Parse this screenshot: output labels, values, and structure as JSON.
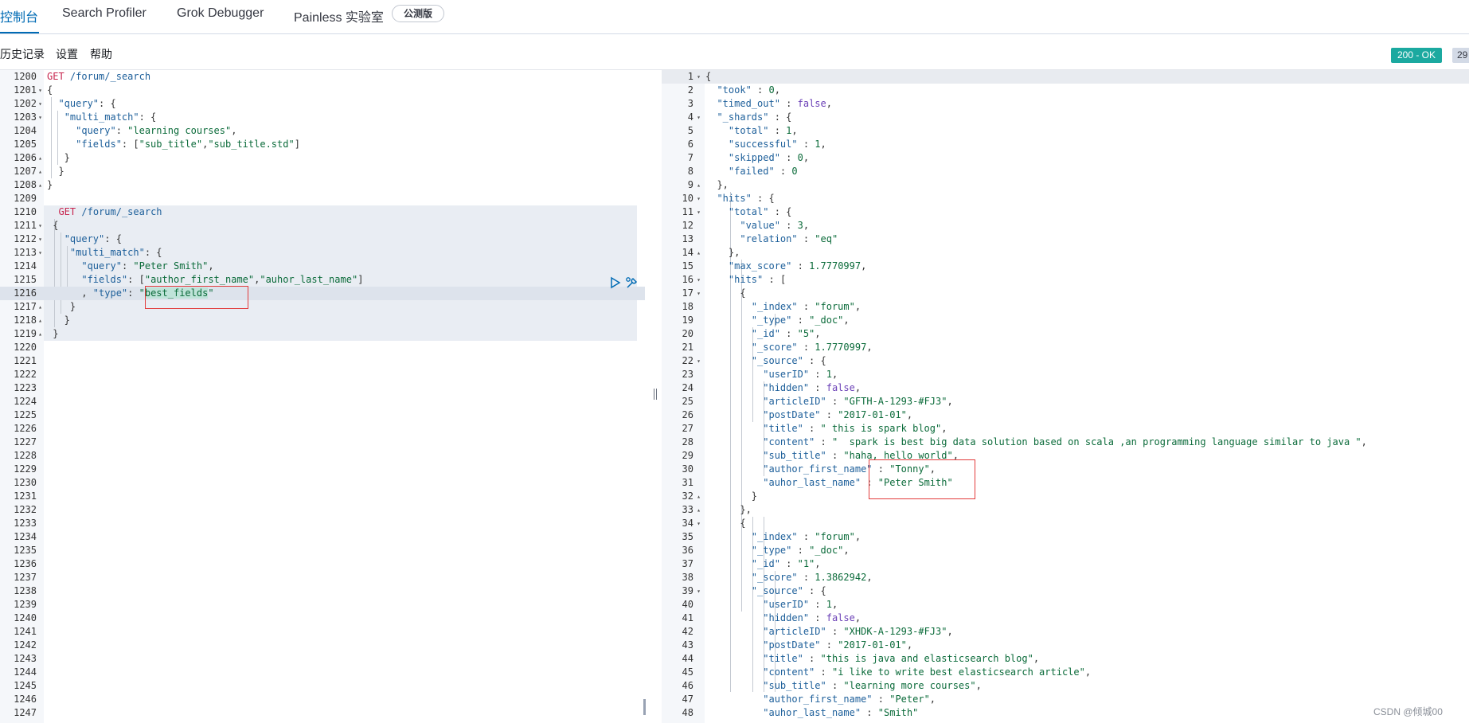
{
  "tabs": {
    "console": "控制台",
    "search_profiler": "Search Profiler",
    "grok_debugger": "Grok Debugger",
    "painless_lab": "Painless 实验室",
    "beta": "公测版"
  },
  "toolbar": {
    "history": "历史记录",
    "settings": "设置",
    "help": "帮助"
  },
  "response_status": {
    "status": "200 - OK",
    "time": "29"
  },
  "request_editor": {
    "lines": [
      {
        "n": "1200",
        "fold": "",
        "code": "GET /forum/_search"
      },
      {
        "n": "1201",
        "fold": "▾",
        "code": "{"
      },
      {
        "n": "1202",
        "fold": "▾",
        "code": "  \"query\": {"
      },
      {
        "n": "1203",
        "fold": "▾",
        "code": "   \"multi_match\": {"
      },
      {
        "n": "1204",
        "fold": "",
        "code": "     \"query\": \"learning courses\","
      },
      {
        "n": "1205",
        "fold": "",
        "code": "     \"fields\": [\"sub_title\",\"sub_title.std\"]"
      },
      {
        "n": "1206",
        "fold": "▴",
        "code": "   }"
      },
      {
        "n": "1207",
        "fold": "▴",
        "code": "  }"
      },
      {
        "n": "1208",
        "fold": "▴",
        "code": "}"
      },
      {
        "n": "1209",
        "fold": "",
        "code": ""
      },
      {
        "n": "1210",
        "fold": "",
        "code": "  GET /forum/_search"
      },
      {
        "n": "1211",
        "fold": "▾",
        "code": " {"
      },
      {
        "n": "1212",
        "fold": "▾",
        "code": "   \"query\": {"
      },
      {
        "n": "1213",
        "fold": "▾",
        "code": "    \"multi_match\": {"
      },
      {
        "n": "1214",
        "fold": "",
        "code": "      \"query\": \"Peter Smith\","
      },
      {
        "n": "1215",
        "fold": "",
        "code": "      \"fields\": [\"author_first_name\",\"auhor_last_name\"]"
      },
      {
        "n": "1216",
        "fold": "",
        "code": "      , \"type\": \"best_fields\""
      },
      {
        "n": "1217",
        "fold": "▴",
        "code": "    }"
      },
      {
        "n": "1218",
        "fold": "▴",
        "code": "   }"
      },
      {
        "n": "1219",
        "fold": "▴",
        "code": " }"
      },
      {
        "n": "1220",
        "fold": "",
        "code": ""
      },
      {
        "n": "1221",
        "fold": "",
        "code": ""
      },
      {
        "n": "1222",
        "fold": "",
        "code": ""
      },
      {
        "n": "1223",
        "fold": "",
        "code": ""
      },
      {
        "n": "1224",
        "fold": "",
        "code": ""
      },
      {
        "n": "1225",
        "fold": "",
        "code": ""
      },
      {
        "n": "1226",
        "fold": "",
        "code": ""
      },
      {
        "n": "1227",
        "fold": "",
        "code": ""
      },
      {
        "n": "1228",
        "fold": "",
        "code": ""
      },
      {
        "n": "1229",
        "fold": "",
        "code": ""
      },
      {
        "n": "1230",
        "fold": "",
        "code": ""
      },
      {
        "n": "1231",
        "fold": "",
        "code": ""
      },
      {
        "n": "1232",
        "fold": "",
        "code": ""
      },
      {
        "n": "1233",
        "fold": "",
        "code": ""
      },
      {
        "n": "1234",
        "fold": "",
        "code": ""
      },
      {
        "n": "1235",
        "fold": "",
        "code": ""
      },
      {
        "n": "1236",
        "fold": "",
        "code": ""
      },
      {
        "n": "1237",
        "fold": "",
        "code": ""
      },
      {
        "n": "1238",
        "fold": "",
        "code": ""
      },
      {
        "n": "1239",
        "fold": "",
        "code": ""
      },
      {
        "n": "1240",
        "fold": "",
        "code": ""
      },
      {
        "n": "1241",
        "fold": "",
        "code": ""
      },
      {
        "n": "1242",
        "fold": "",
        "code": ""
      },
      {
        "n": "1243",
        "fold": "",
        "code": ""
      },
      {
        "n": "1244",
        "fold": "",
        "code": ""
      },
      {
        "n": "1245",
        "fold": "",
        "code": ""
      },
      {
        "n": "1246",
        "fold": "",
        "code": ""
      },
      {
        "n": "1247",
        "fold": "",
        "code": ""
      }
    ]
  },
  "response_editor": {
    "lines": [
      {
        "n": "1",
        "fold": "▾",
        "code": "{"
      },
      {
        "n": "2",
        "fold": "",
        "code": "  \"took\" : 0,"
      },
      {
        "n": "3",
        "fold": "",
        "code": "  \"timed_out\" : false,"
      },
      {
        "n": "4",
        "fold": "▾",
        "code": "  \"_shards\" : {"
      },
      {
        "n": "5",
        "fold": "",
        "code": "    \"total\" : 1,"
      },
      {
        "n": "6",
        "fold": "",
        "code": "    \"successful\" : 1,"
      },
      {
        "n": "7",
        "fold": "",
        "code": "    \"skipped\" : 0,"
      },
      {
        "n": "8",
        "fold": "",
        "code": "    \"failed\" : 0"
      },
      {
        "n": "9",
        "fold": "▴",
        "code": "  },"
      },
      {
        "n": "10",
        "fold": "▾",
        "code": "  \"hits\" : {"
      },
      {
        "n": "11",
        "fold": "▾",
        "code": "    \"total\" : {"
      },
      {
        "n": "12",
        "fold": "",
        "code": "      \"value\" : 3,"
      },
      {
        "n": "13",
        "fold": "",
        "code": "      \"relation\" : \"eq\""
      },
      {
        "n": "14",
        "fold": "▴",
        "code": "    },"
      },
      {
        "n": "15",
        "fold": "",
        "code": "    \"max_score\" : 1.7770997,"
      },
      {
        "n": "16",
        "fold": "▾",
        "code": "    \"hits\" : ["
      },
      {
        "n": "17",
        "fold": "▾",
        "code": "      {"
      },
      {
        "n": "18",
        "fold": "",
        "code": "        \"_index\" : \"forum\","
      },
      {
        "n": "19",
        "fold": "",
        "code": "        \"_type\" : \"_doc\","
      },
      {
        "n": "20",
        "fold": "",
        "code": "        \"_id\" : \"5\","
      },
      {
        "n": "21",
        "fold": "",
        "code": "        \"_score\" : 1.7770997,"
      },
      {
        "n": "22",
        "fold": "▾",
        "code": "        \"_source\" : {"
      },
      {
        "n": "23",
        "fold": "",
        "code": "          \"userID\" : 1,"
      },
      {
        "n": "24",
        "fold": "",
        "code": "          \"hidden\" : false,"
      },
      {
        "n": "25",
        "fold": "",
        "code": "          \"articleID\" : \"GFTH-A-1293-#FJ3\","
      },
      {
        "n": "26",
        "fold": "",
        "code": "          \"postDate\" : \"2017-01-01\","
      },
      {
        "n": "27",
        "fold": "",
        "code": "          \"title\" : \" this is spark blog\","
      },
      {
        "n": "28",
        "fold": "",
        "code": "          \"content\" : \"  spark is best big data solution based on scala ,an programming language similar to java \","
      },
      {
        "n": "29",
        "fold": "",
        "code": "          \"sub_title\" : \"haha, hello world\","
      },
      {
        "n": "30",
        "fold": "",
        "code": "          \"author_first_name\" : \"Tonny\","
      },
      {
        "n": "31",
        "fold": "",
        "code": "          \"auhor_last_name\" : \"Peter Smith\""
      },
      {
        "n": "32",
        "fold": "▴",
        "code": "        }"
      },
      {
        "n": "33",
        "fold": "▴",
        "code": "      },"
      },
      {
        "n": "34",
        "fold": "▾",
        "code": "      {"
      },
      {
        "n": "35",
        "fold": "",
        "code": "        \"_index\" : \"forum\","
      },
      {
        "n": "36",
        "fold": "",
        "code": "        \"_type\" : \"_doc\","
      },
      {
        "n": "37",
        "fold": "",
        "code": "        \"_id\" : \"1\","
      },
      {
        "n": "38",
        "fold": "",
        "code": "        \"_score\" : 1.3862942,"
      },
      {
        "n": "39",
        "fold": "▾",
        "code": "        \"_source\" : {"
      },
      {
        "n": "40",
        "fold": "",
        "code": "          \"userID\" : 1,"
      },
      {
        "n": "41",
        "fold": "",
        "code": "          \"hidden\" : false,"
      },
      {
        "n": "42",
        "fold": "",
        "code": "          \"articleID\" : \"XHDK-A-1293-#FJ3\","
      },
      {
        "n": "43",
        "fold": "",
        "code": "          \"postDate\" : \"2017-01-01\","
      },
      {
        "n": "44",
        "fold": "",
        "code": "          \"title\" : \"this is java and elasticsearch blog\","
      },
      {
        "n": "45",
        "fold": "",
        "code": "          \"content\" : \"i like to write best elasticsearch article\","
      },
      {
        "n": "46",
        "fold": "",
        "code": "          \"sub_title\" : \"learning more courses\","
      },
      {
        "n": "47",
        "fold": "",
        "code": "          \"author_first_name\" : \"Peter\","
      },
      {
        "n": "48",
        "fold": "",
        "code": "          \"auhor_last_name\" : \"Smith\""
      }
    ]
  },
  "watermark": "CSDN @倾城00",
  "icons": {
    "run": "play-icon",
    "options": "wrench-icon"
  },
  "colors": {
    "accent": "#006bb4",
    "status_ok": "#1ba9a0",
    "highlight_box": "#e23b3b"
  }
}
